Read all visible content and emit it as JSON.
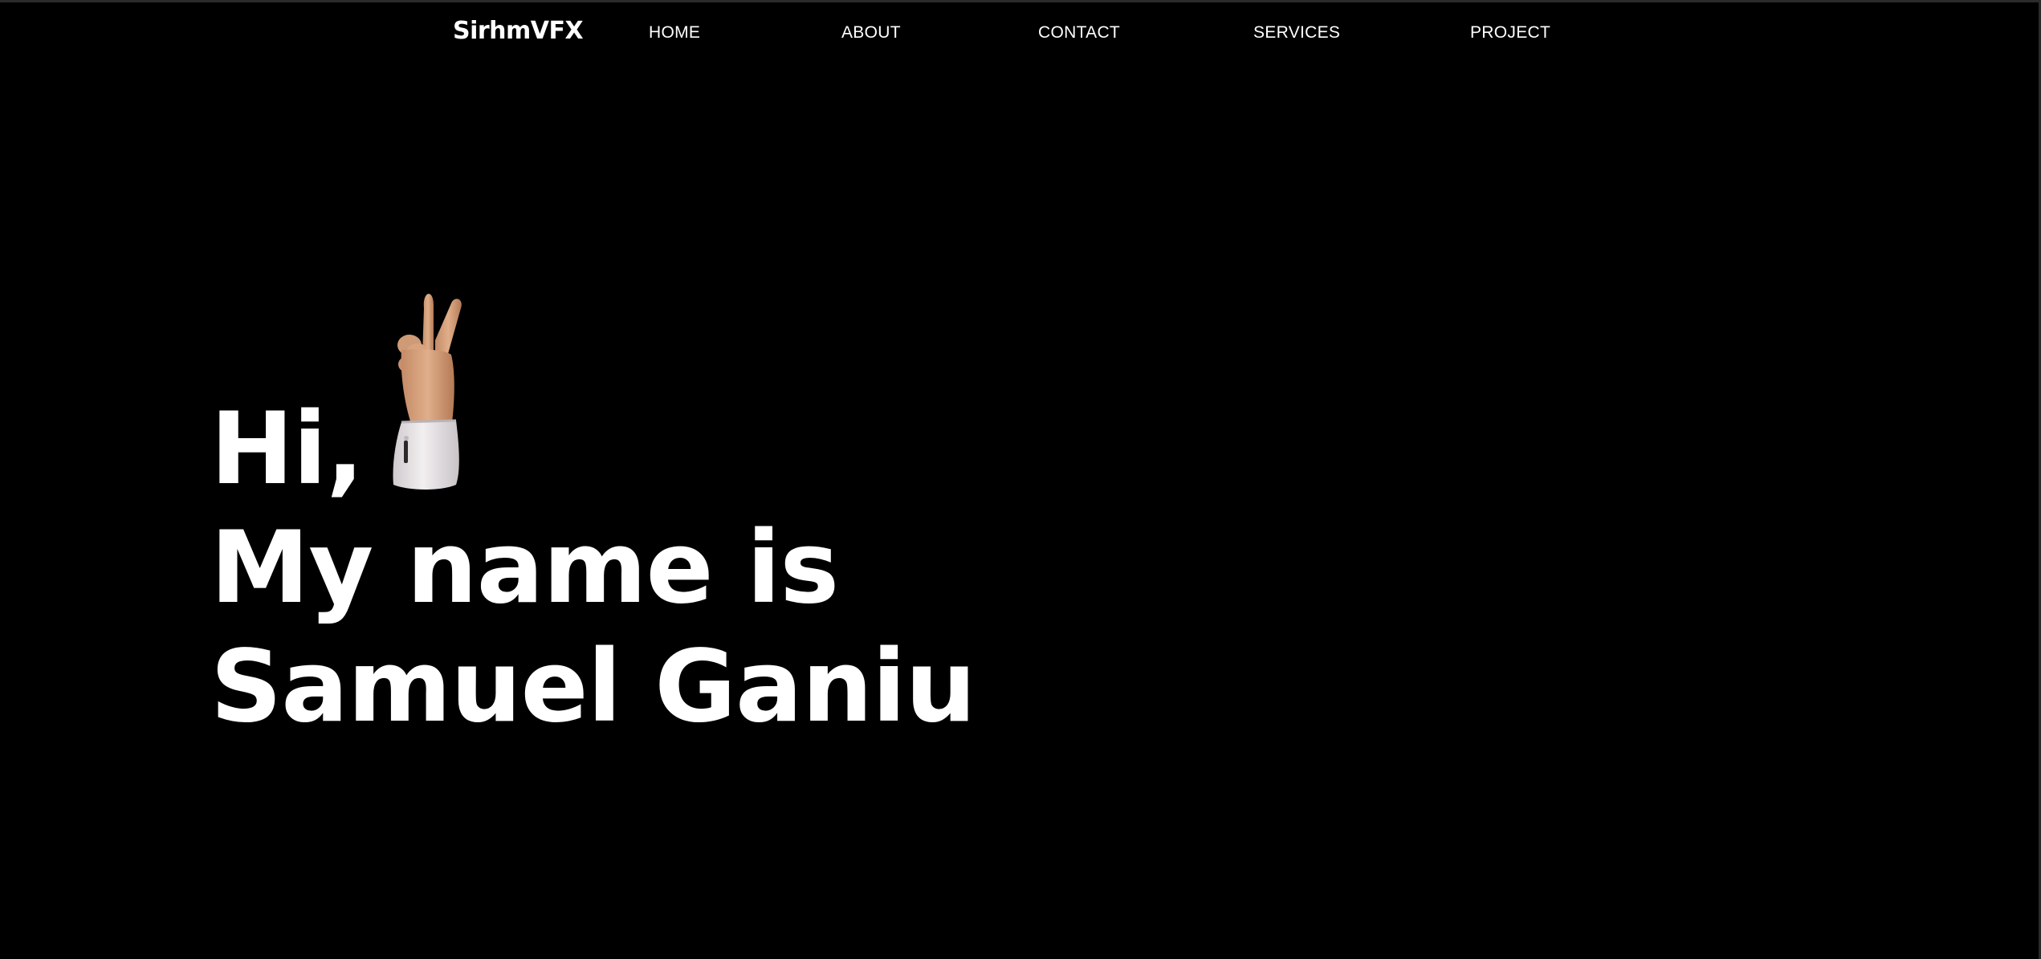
{
  "nav": {
    "brand": "SirhmVFX",
    "links": [
      {
        "label": "HOME"
      },
      {
        "label": "ABOUT"
      },
      {
        "label": "CONTACT"
      },
      {
        "label": "SERVICES"
      },
      {
        "label": "PROJECT"
      }
    ]
  },
  "hero": {
    "line1": "Hi,",
    "line2": "My name is",
    "line3": "Samuel Ganiu",
    "image": "peace-hand-emoji-3d"
  },
  "colors": {
    "background": "#000000",
    "text": "#ffffff",
    "skin": "#d8a47f",
    "sleeve": "#e9e6e8"
  }
}
